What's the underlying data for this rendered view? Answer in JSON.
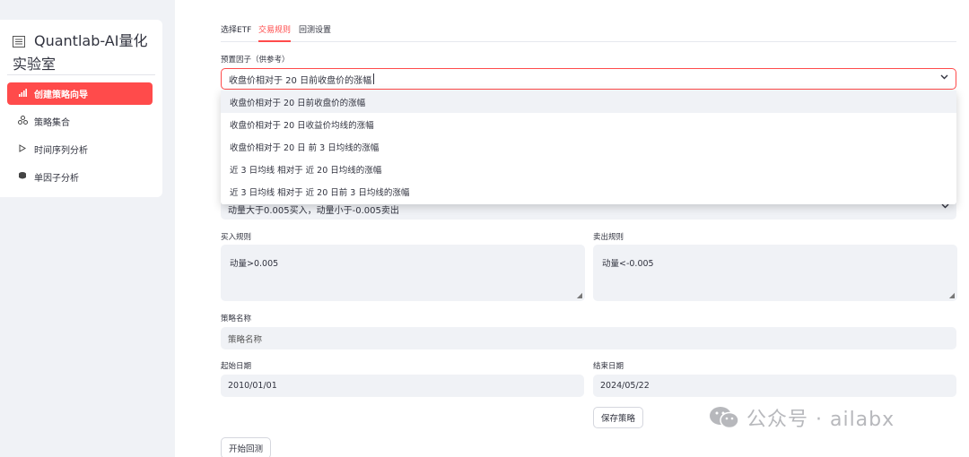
{
  "sidebar": {
    "title": "Quantlab-AI量化实验室",
    "items": [
      {
        "label": "创建策略向导",
        "icon": "bar-chart-icon",
        "active": true
      },
      {
        "label": "策略集合",
        "icon": "cluster-icon",
        "active": false
      },
      {
        "label": "时间序列分析",
        "icon": "play-icon",
        "active": false
      },
      {
        "label": "单因子分析",
        "icon": "coins-icon",
        "active": false
      }
    ]
  },
  "tabs": [
    "选择ETF",
    "交易规则",
    "回测设置"
  ],
  "active_tab": "交易规则",
  "factor": {
    "label": "预置因子（供参考）",
    "value": "收盘价相对于 20 日前收盘价的涨幅",
    "options": [
      "收盘价相对于 20 日前收盘价的涨幅",
      "收盘价相对于 20 日收益价均线的涨幅",
      "收盘价相对于 20 日 前 3 日均线的涨幅",
      "近 3 日均线 相对于 近 20 日均线的涨幅",
      "近 3 日均线 相对于 近 20 日前 3 日均线的涨幅"
    ]
  },
  "rule_select": {
    "value": "动量大于0.005买入，动量小于-0.005卖出"
  },
  "buy_rule": {
    "label": "买入规则",
    "value": "动量>0.005"
  },
  "sell_rule": {
    "label": "卖出规则",
    "value": "动量<-0.005"
  },
  "strategy_name": {
    "label": "策略名称",
    "placeholder": "策略名称"
  },
  "start_date": {
    "label": "起始日期",
    "value": "2010/01/01"
  },
  "end_date": {
    "label": "结束日期",
    "value": "2024/05/22"
  },
  "buttons": {
    "save": "保存策略",
    "backtest": "开始回测"
  },
  "watermark": "公众号 · ailabx",
  "colors": {
    "accent": "#ff4b4b",
    "input_bg": "#f0f2f6"
  }
}
